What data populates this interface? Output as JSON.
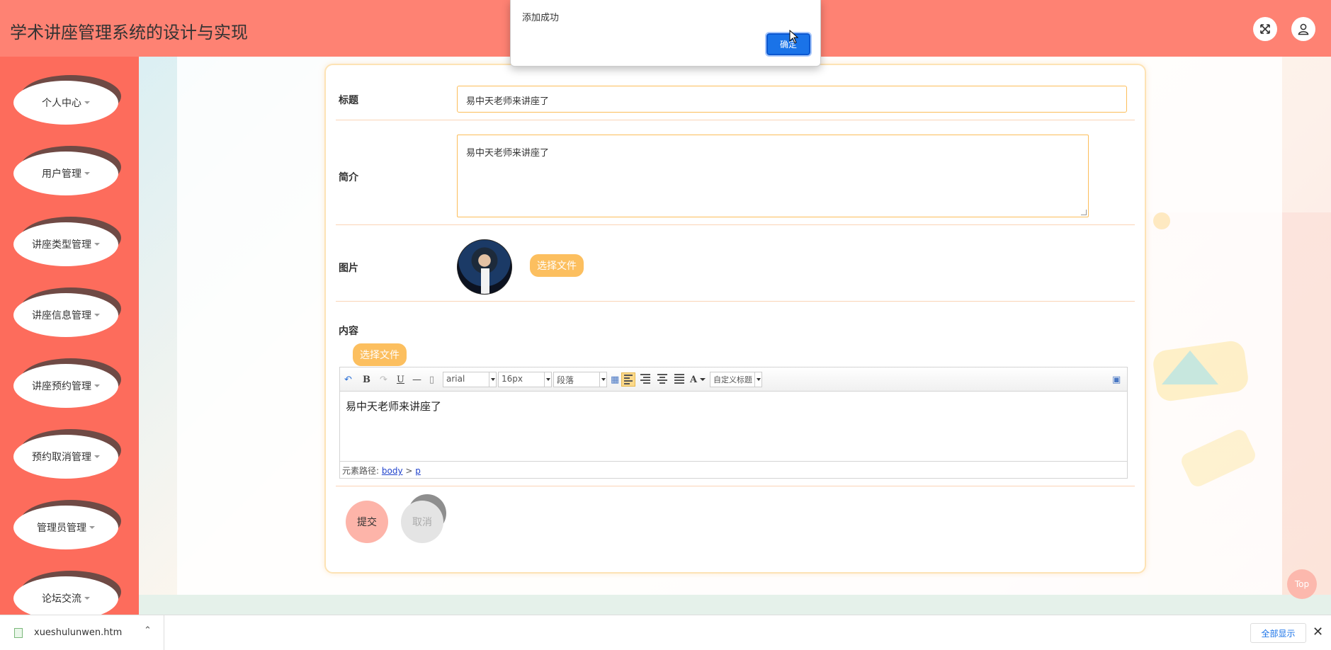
{
  "header": {
    "title": "学术讲座管理系统的设计与实现"
  },
  "sidebar": {
    "items": [
      {
        "label": "个人中心"
      },
      {
        "label": "用户管理"
      },
      {
        "label": "讲座类型管理"
      },
      {
        "label": "讲座信息管理"
      },
      {
        "label": "讲座预约管理"
      },
      {
        "label": "预约取消管理"
      },
      {
        "label": "管理员管理"
      },
      {
        "label": "论坛交流"
      }
    ]
  },
  "form": {
    "title_label": "标题",
    "title_value": "易中天老师来讲座了",
    "intro_label": "简介",
    "intro_value": "易中天老师来讲座了",
    "image_label": "图片",
    "image_file_button": "选择文件",
    "content_label": "内容",
    "content_file_button": "选择文件",
    "submit_label": "提交",
    "cancel_label": "取消"
  },
  "editor": {
    "font_family": "arial",
    "font_size": "16px",
    "paragraph": "段落",
    "custom_title": "自定义标题",
    "body_text": "易中天老师来讲座了",
    "path_label": "元素路径:",
    "path_body": "body",
    "path_sep": ">",
    "path_p": "p"
  },
  "top_button": "Top",
  "dialog": {
    "message": "添加成功",
    "ok_label": "确定"
  },
  "download_bar": {
    "file_name": "xueshulunwen.htm",
    "show_all": "全部显示"
  }
}
